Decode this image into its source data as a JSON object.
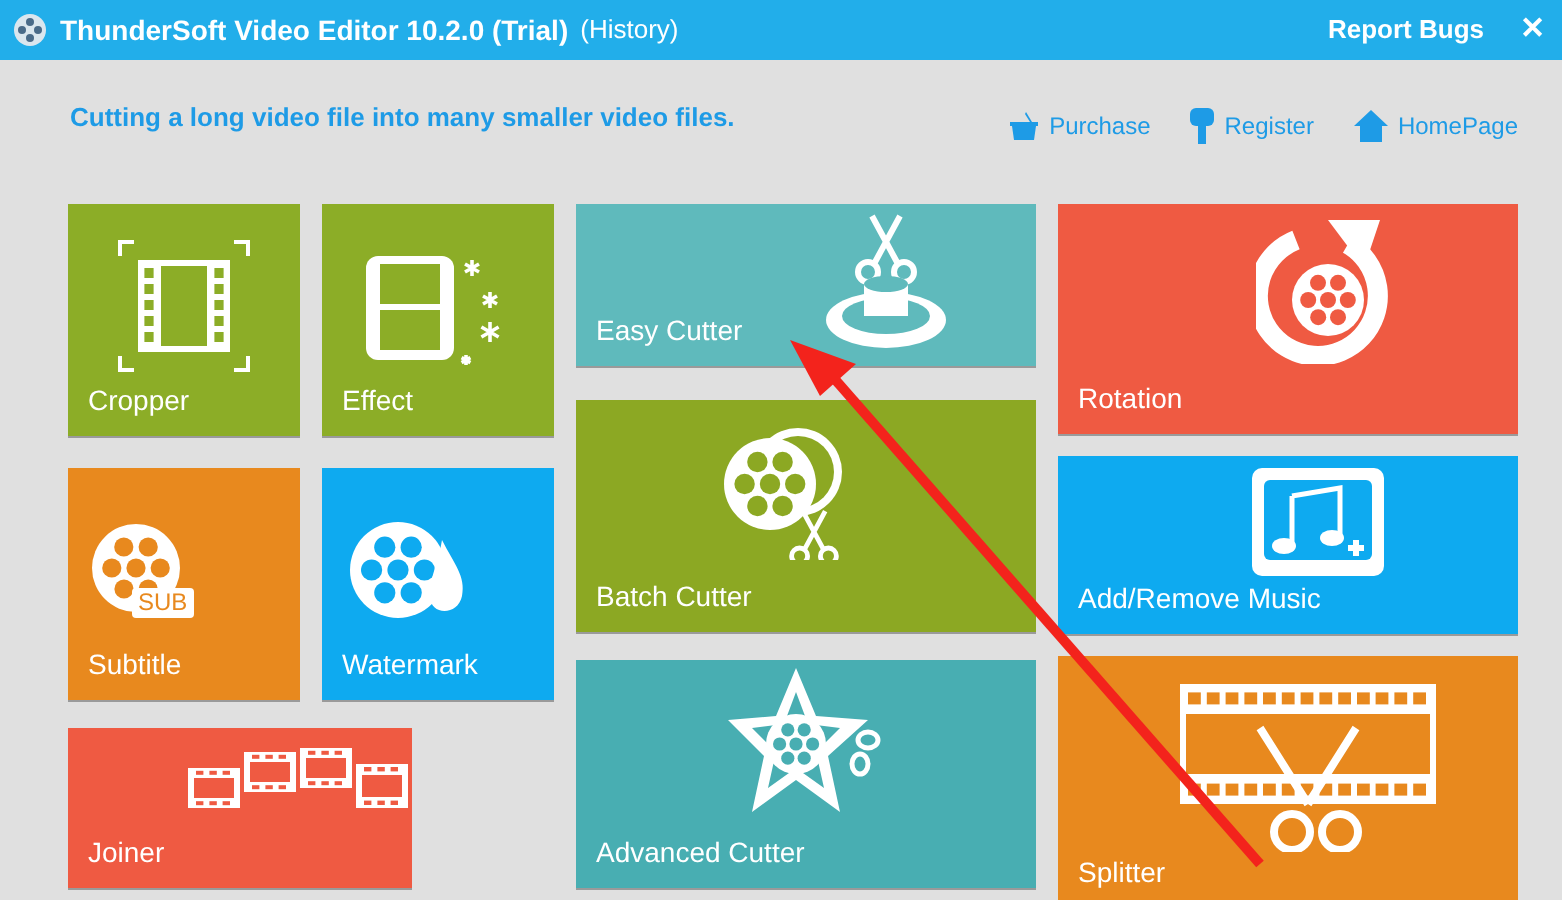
{
  "window": {
    "title": "ThunderSoft Video Editor 10.2.0 (Trial)",
    "history_link": "(History)",
    "report_link": "Report Bugs",
    "close": "✕"
  },
  "tagline": "Cutting a long video file into many smaller video files.",
  "links": [
    {
      "label": "Purchase",
      "kind": "basket"
    },
    {
      "label": "Register",
      "kind": "key"
    },
    {
      "label": "HomePage",
      "kind": "home"
    }
  ],
  "tiles": [
    {
      "label": "Cropper",
      "kind": "crop",
      "color": "#8cad27"
    },
    {
      "label": "Effect",
      "kind": "effect",
      "color": "#8cad27"
    },
    {
      "label": "Subtitle",
      "kind": "subtitle",
      "color": "#e8891e",
      "badge": "SUB"
    },
    {
      "label": "Watermark",
      "kind": "watermark",
      "color": "#0eaaf0"
    },
    {
      "label": "Joiner",
      "kind": "joiner",
      "color": "#ef5a42"
    },
    {
      "label": "Easy Cutter",
      "kind": "easy",
      "color": "#5fbabc"
    },
    {
      "label": "Batch Cutter",
      "kind": "batch",
      "color": "#8ca823"
    },
    {
      "label": "Advanced Cutter",
      "kind": "advanced",
      "color": "#48aeb2"
    },
    {
      "label": "Rotation",
      "kind": "rotation",
      "color": "#ef5a42"
    },
    {
      "label": "Add/Remove Music",
      "kind": "music",
      "color": "#0eaaf0"
    },
    {
      "label": "Splitter",
      "kind": "splitter",
      "color": "#e8891e"
    }
  ]
}
